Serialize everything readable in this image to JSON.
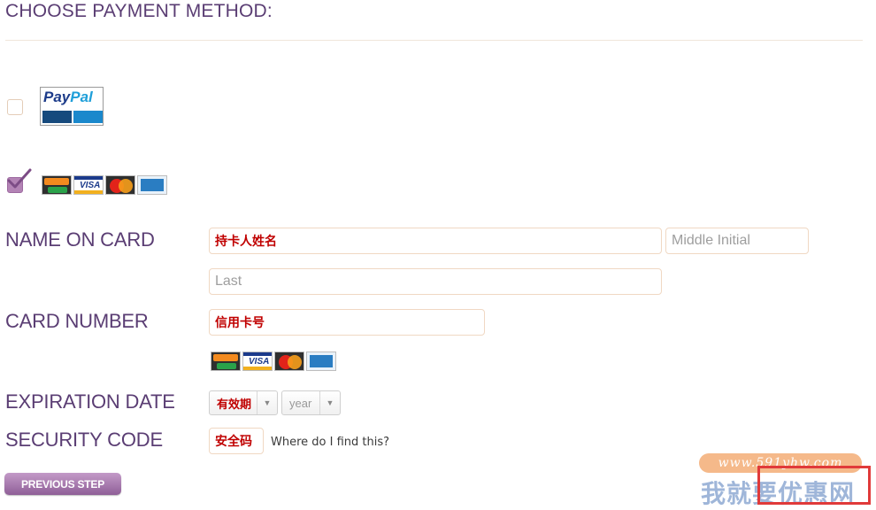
{
  "page": {
    "heading": "CHOOSE PAYMENT METHOD:"
  },
  "payment_options": {
    "paypal": {
      "logo_text_a": "Pay",
      "logo_text_b": "Pal",
      "checked": false
    },
    "credit_card": {
      "checked": true,
      "brands": [
        "discover-icon",
        "visa-icon",
        "mastercard-icon",
        "amex-icon"
      ]
    }
  },
  "form": {
    "name_label": "NAME ON CARD",
    "first_value": "持卡人姓名",
    "middle_placeholder": "Middle Initial",
    "last_placeholder": "Last",
    "card_number_label": "CARD NUMBER",
    "card_number_value": "信用卡号",
    "expiration_label": "EXPIRATION DATE",
    "month_value": "有效期",
    "year_value": "year",
    "security_label": "SECURITY CODE",
    "security_value": "安全码",
    "help_link": "Where do I find this?"
  },
  "buttons": {
    "previous_step": "PREVIOUS STEP"
  },
  "watermark": {
    "url": "www.591yhw.com",
    "text": "我就要优惠网"
  },
  "colors": {
    "heading": "#5a3d73",
    "accent": "#b383b5",
    "field_border": "#f0d8c3",
    "red_text": "#c00000"
  }
}
